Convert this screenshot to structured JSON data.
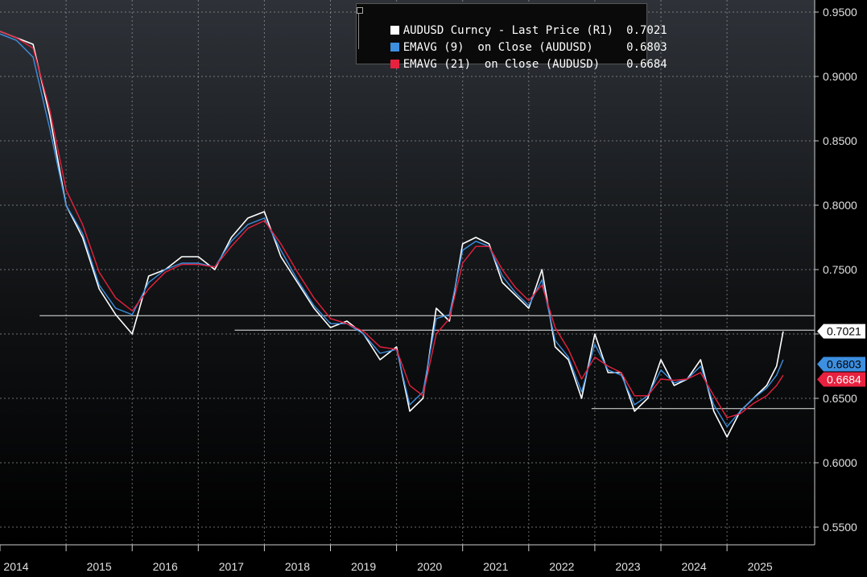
{
  "chart_data": {
    "type": "line",
    "title": "",
    "xlabel": "",
    "ylabel": "",
    "xlim": [
      2014.0,
      2025.9
    ],
    "ylim": [
      0.54,
      0.96
    ],
    "x_ticks": [
      "2014",
      "2015",
      "2016",
      "2017",
      "2018",
      "2019",
      "2020",
      "2021",
      "2022",
      "2023",
      "2024",
      "2025"
    ],
    "y_ticks": [
      "0.9500",
      "0.9000",
      "0.8500",
      "0.8000",
      "0.7500",
      "0.7000",
      "0.6500",
      "0.6000",
      "0.5500"
    ],
    "y_tick_values": [
      0.95,
      0.9,
      0.85,
      0.8,
      0.75,
      0.7,
      0.65,
      0.6,
      0.55
    ],
    "grid": true,
    "legend": {
      "position": "top-center"
    },
    "series": [
      {
        "name": "AUDUSD Curncy - Last Price (R1)",
        "last_value": "0.7021",
        "color": "#ffffff",
        "x": [
          2014.0,
          2014.25,
          2014.5,
          2014.75,
          2015.0,
          2015.25,
          2015.5,
          2015.75,
          2016.0,
          2016.25,
          2016.5,
          2016.75,
          2017.0,
          2017.25,
          2017.5,
          2017.75,
          2018.0,
          2018.25,
          2018.5,
          2018.75,
          2019.0,
          2019.25,
          2019.5,
          2019.75,
          2020.0,
          2020.2,
          2020.4,
          2020.6,
          2020.8,
          2021.0,
          2021.2,
          2021.4,
          2021.6,
          2021.8,
          2022.0,
          2022.2,
          2022.4,
          2022.6,
          2022.8,
          2023.0,
          2023.2,
          2023.4,
          2023.6,
          2023.8,
          2024.0,
          2024.2,
          2024.4,
          2024.6,
          2024.8,
          2025.0,
          2025.2,
          2025.4,
          2025.6,
          2025.75,
          2025.85
        ],
        "y": [
          0.935,
          0.93,
          0.925,
          0.87,
          0.8,
          0.775,
          0.735,
          0.715,
          0.7,
          0.745,
          0.75,
          0.76,
          0.76,
          0.75,
          0.775,
          0.79,
          0.795,
          0.76,
          0.74,
          0.72,
          0.705,
          0.71,
          0.7,
          0.68,
          0.69,
          0.64,
          0.65,
          0.72,
          0.71,
          0.77,
          0.775,
          0.77,
          0.74,
          0.73,
          0.72,
          0.75,
          0.69,
          0.68,
          0.65,
          0.7,
          0.67,
          0.67,
          0.64,
          0.65,
          0.68,
          0.66,
          0.665,
          0.68,
          0.64,
          0.62,
          0.64,
          0.65,
          0.66,
          0.675,
          0.702
        ]
      },
      {
        "name": "EMAVG (9)  on Close (AUDUSD)",
        "last_value": "0.6803",
        "color": "#3d8fe0",
        "x": [
          2014.0,
          2014.25,
          2014.5,
          2014.75,
          2015.0,
          2015.25,
          2015.5,
          2015.75,
          2016.0,
          2016.25,
          2016.5,
          2016.75,
          2017.0,
          2017.25,
          2017.5,
          2017.75,
          2018.0,
          2018.25,
          2018.5,
          2018.75,
          2019.0,
          2019.25,
          2019.5,
          2019.75,
          2020.0,
          2020.2,
          2020.4,
          2020.6,
          2020.8,
          2021.0,
          2021.2,
          2021.4,
          2021.6,
          2021.8,
          2022.0,
          2022.2,
          2022.4,
          2022.6,
          2022.8,
          2023.0,
          2023.2,
          2023.4,
          2023.6,
          2023.8,
          2024.0,
          2024.2,
          2024.4,
          2024.6,
          2024.8,
          2025.0,
          2025.2,
          2025.4,
          2025.6,
          2025.75,
          2025.85
        ],
        "y": [
          0.933,
          0.928,
          0.915,
          0.86,
          0.8,
          0.778,
          0.738,
          0.72,
          0.715,
          0.74,
          0.75,
          0.755,
          0.755,
          0.752,
          0.772,
          0.785,
          0.79,
          0.765,
          0.742,
          0.722,
          0.708,
          0.708,
          0.7,
          0.685,
          0.688,
          0.645,
          0.655,
          0.712,
          0.715,
          0.765,
          0.772,
          0.768,
          0.745,
          0.732,
          0.722,
          0.742,
          0.695,
          0.682,
          0.655,
          0.692,
          0.672,
          0.668,
          0.645,
          0.652,
          0.672,
          0.662,
          0.665,
          0.675,
          0.645,
          0.628,
          0.64,
          0.65,
          0.658,
          0.668,
          0.68
        ]
      },
      {
        "name": "EMAVG (21)  on Close (AUDUSD)",
        "last_value": "0.6684",
        "color": "#e8213f",
        "x": [
          2014.0,
          2014.25,
          2014.5,
          2014.75,
          2015.0,
          2015.25,
          2015.5,
          2015.75,
          2016.0,
          2016.25,
          2016.5,
          2016.75,
          2017.0,
          2017.25,
          2017.5,
          2017.75,
          2018.0,
          2018.25,
          2018.5,
          2018.75,
          2019.0,
          2019.25,
          2019.5,
          2019.75,
          2020.0,
          2020.2,
          2020.4,
          2020.6,
          2020.8,
          2021.0,
          2021.2,
          2021.4,
          2021.6,
          2021.8,
          2022.0,
          2022.2,
          2022.4,
          2022.6,
          2022.8,
          2023.0,
          2023.2,
          2023.4,
          2023.6,
          2023.8,
          2024.0,
          2024.2,
          2024.4,
          2024.6,
          2024.8,
          2025.0,
          2025.2,
          2025.4,
          2025.6,
          2025.75,
          2025.85
        ],
        "y": [
          0.935,
          0.93,
          0.922,
          0.875,
          0.812,
          0.785,
          0.748,
          0.728,
          0.718,
          0.735,
          0.748,
          0.754,
          0.754,
          0.752,
          0.768,
          0.782,
          0.788,
          0.77,
          0.748,
          0.728,
          0.712,
          0.708,
          0.702,
          0.69,
          0.688,
          0.66,
          0.652,
          0.7,
          0.712,
          0.755,
          0.768,
          0.768,
          0.75,
          0.736,
          0.726,
          0.738,
          0.705,
          0.688,
          0.665,
          0.682,
          0.675,
          0.67,
          0.652,
          0.652,
          0.665,
          0.664,
          0.665,
          0.67,
          0.652,
          0.635,
          0.638,
          0.646,
          0.652,
          0.66,
          0.668
        ]
      }
    ],
    "reference_lines": [
      {
        "y": 0.7142,
        "x_start": 2014.6,
        "x_end": 2025.9
      },
      {
        "y": 0.703,
        "x_start": 2017.55,
        "x_end": 2025.9
      },
      {
        "y": 0.642,
        "x_start": 2022.95,
        "x_end": 2025.9
      }
    ]
  },
  "legend": {
    "rows": [
      {
        "label": "AUDUSD Curncy - Last Price (R1)",
        "value": "0.7021"
      },
      {
        "label": "EMAVG (9)  on Close (AUDUSD)",
        "value": "0.6803"
      },
      {
        "label": "EMAVG (21)  on Close (AUDUSD)",
        "value": "0.6684"
      }
    ]
  }
}
